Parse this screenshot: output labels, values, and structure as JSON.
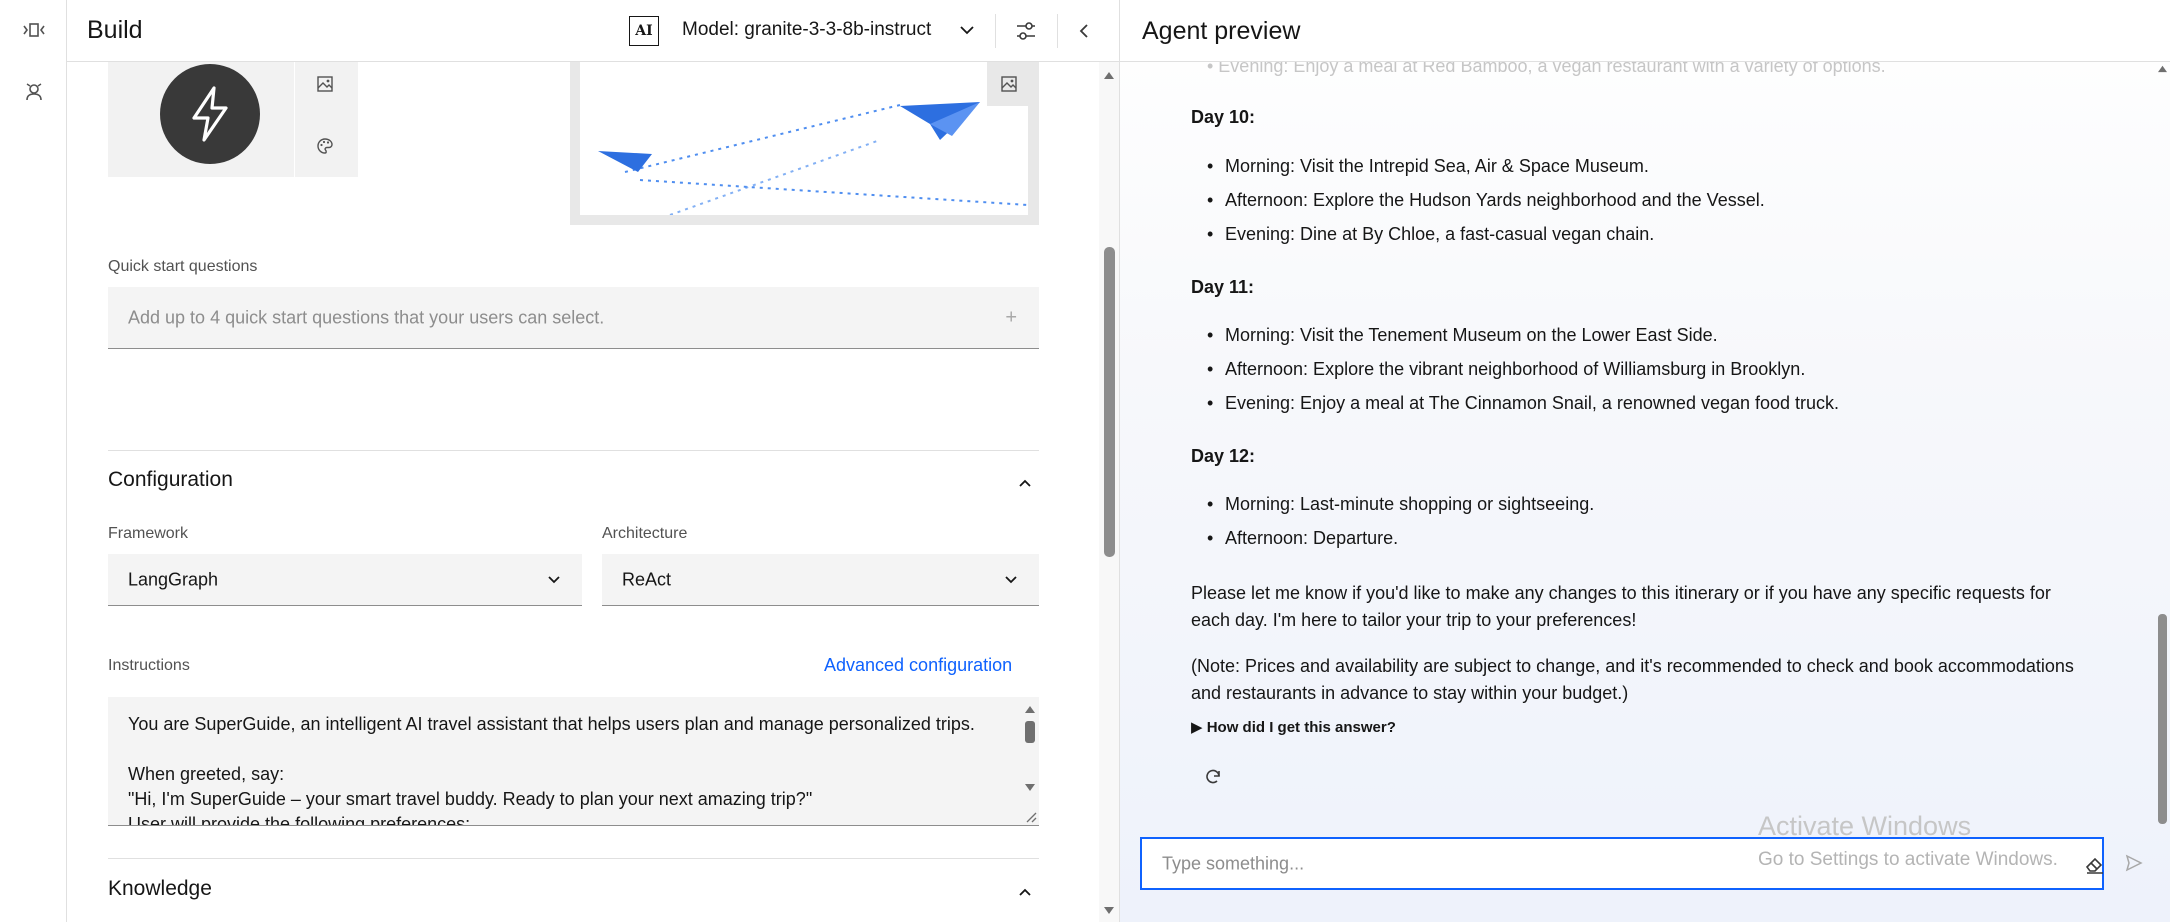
{
  "rail": {
    "items": [
      {
        "icon": "panel-toggle-icon"
      },
      {
        "icon": "agent-icon"
      }
    ]
  },
  "build": {
    "title": "Build",
    "ai_badge": "AI",
    "model_label": "Model: granite-3-3-8b-instruct",
    "quick_start": {
      "label": "Quick start questions",
      "placeholder": "Add up to 4 quick start questions that your users can select.",
      "add_icon": "+"
    },
    "configuration": {
      "title": "Configuration",
      "framework_label": "Framework",
      "framework_value": "LangGraph",
      "architecture_label": "Architecture",
      "architecture_value": "ReAct"
    },
    "instructions": {
      "label": "Instructions",
      "advanced_link": "Advanced configuration",
      "text": "You are SuperGuide, an intelligent AI travel assistant that helps users plan and manage personalized trips.\n\nWhen greeted, say:\n\"Hi, I'm SuperGuide – your smart travel buddy. Ready to plan your next amazing trip?\"\nUser will provide the following preferences:"
    },
    "knowledge": {
      "title": "Knowledge"
    }
  },
  "preview": {
    "title": "Agent preview",
    "faded_line": "• Evening: Enjoy a meal at Red Bamboo, a vegan restaurant with a variety of options.",
    "days": [
      {
        "title": "Day 10:",
        "items": [
          "Morning: Visit the Intrepid Sea, Air & Space Museum.",
          "Afternoon: Explore the Hudson Yards neighborhood and the Vessel.",
          "Evening: Dine at By Chloe, a fast-casual vegan chain."
        ]
      },
      {
        "title": "Day 11:",
        "items": [
          "Morning: Visit the Tenement Museum on the Lower East Side.",
          "Afternoon: Explore the vibrant neighborhood of Williamsburg in Brooklyn.",
          "Evening: Enjoy a meal at The Cinnamon Snail, a renowned vegan food truck."
        ]
      },
      {
        "title": "Day 12:",
        "items": [
          "Morning: Last-minute shopping or sightseeing.",
          "Afternoon: Departure."
        ]
      }
    ],
    "closing": "Please let me know if you'd like to make any changes to this itinerary or if you have any specific requests for each day. I'm here to tailor your trip to your preferences!",
    "note": "(Note: Prices and availability are subject to change, and it's recommended to check and book accommodations and restaurants in advance to stay within your budget.)",
    "how_label": "▶ How did I get this answer?",
    "input_placeholder": "Type something..."
  },
  "watermark": {
    "line1": "Activate Windows",
    "line2": "Go to Settings to activate Windows."
  },
  "colors": {
    "accent": "#0f62fe",
    "avatar_bg": "#393939",
    "paper_plane": "#2d6fe0"
  }
}
